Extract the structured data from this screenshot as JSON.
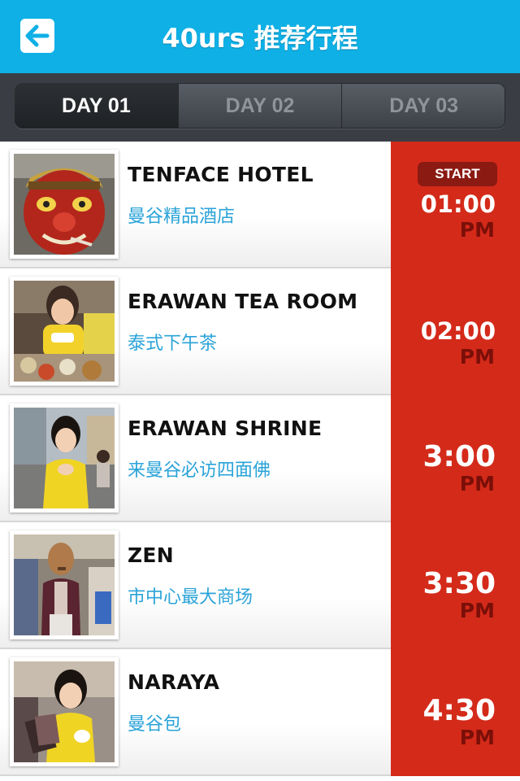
{
  "header": {
    "title": "40urs 推荐行程",
    "back_icon": "back-arrow-icon",
    "color": "#0fb0e6"
  },
  "tabs": [
    {
      "label": "DAY 01",
      "active": true
    },
    {
      "label": "DAY 02",
      "active": false
    },
    {
      "label": "DAY 03",
      "active": false
    }
  ],
  "itinerary": [
    {
      "name": "TENFACE HOTEL",
      "subtitle": "曼谷精品酒店",
      "time": "01:00",
      "ampm": "PM",
      "badge": "START",
      "image": "red-mask-photo"
    },
    {
      "name": "ERAWAN TEA ROOM",
      "subtitle": "泰式下午茶",
      "time": "02:00",
      "ampm": "PM",
      "image": "tea-room-photo"
    },
    {
      "name": "ERAWAN SHRINE",
      "subtitle": "来曼谷必访四面佛",
      "time": "3:00",
      "ampm": "PM",
      "image": "shrine-photo"
    },
    {
      "name": "ZEN",
      "subtitle": "市中心最大商场",
      "time": "3:30",
      "ampm": "PM",
      "image": "mall-photo"
    },
    {
      "name": "NARAYA",
      "subtitle": "曼谷包",
      "time": "4:30",
      "ampm": "PM",
      "image": "naraya-photo"
    }
  ],
  "colors": {
    "time_bg": "#d42a1a",
    "subtitle": "#2aa3d8"
  }
}
